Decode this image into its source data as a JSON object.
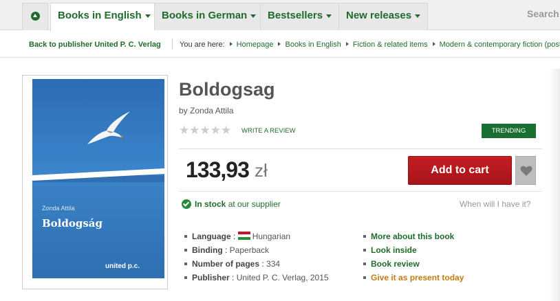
{
  "nav": {
    "tabs": [
      "Books in English",
      "Books in German",
      "Bestsellers",
      "New releases"
    ],
    "search_label": "Search"
  },
  "breadcrumb": {
    "back_link": "Back to publisher United P. C. Verlag",
    "prefix": "You are here:",
    "items": [
      "Homepage",
      "Books in English",
      "Fiction & related items",
      "Modern & contemporary fiction (post c"
    ]
  },
  "cover": {
    "author": "Zonda Attila",
    "title": "Boldogság",
    "publisher_mark": "united p.c."
  },
  "product": {
    "title": "Boldogsag",
    "by_prefix": "by",
    "author": "Zonda Attila",
    "stars": "★★★★★",
    "write_review": "WRITE A REVIEW",
    "badge": "TRENDING",
    "price": "133,93",
    "currency": "zł",
    "add_to_cart": "Add to cart",
    "stock_status": "In stock",
    "stock_rest": "at our supplier",
    "when": "When will I have it?"
  },
  "details": [
    {
      "key": "Language",
      "value": "Hungarian"
    },
    {
      "key": "Binding",
      "value": "Paperback"
    },
    {
      "key": "Number of pages",
      "value": "334"
    },
    {
      "key": "Publisher",
      "value": "United P. C. Verlag, 2015"
    }
  ],
  "links": [
    "More about this book",
    "Look inside",
    "Book review",
    "Give it as present today"
  ],
  "colors": {
    "brand_green": "#1f6b2b",
    "cart_red": "#c41e22",
    "present_orange": "#c47b10"
  }
}
